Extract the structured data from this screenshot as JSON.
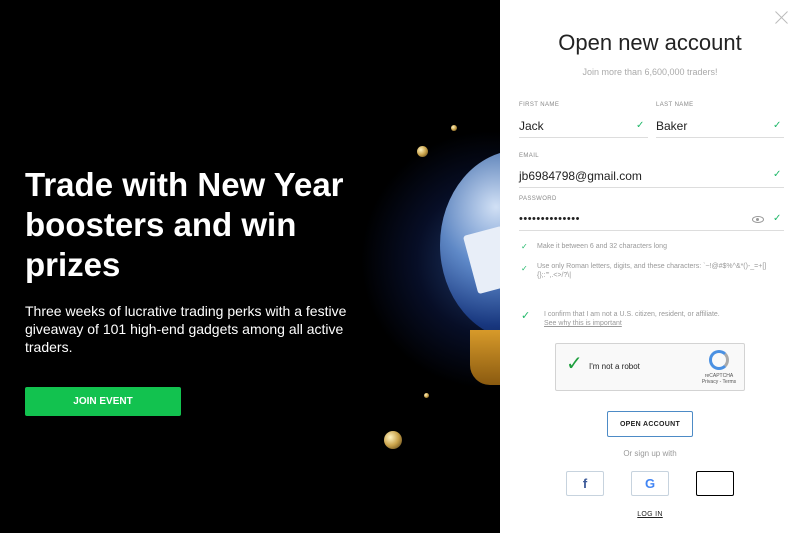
{
  "promo": {
    "headline": "Trade with New Year boosters and win prizes",
    "subtext": "Three weeks of lucrative trading perks with a festive giveaway of 101 high-end gadgets among all active traders.",
    "join_label": "JOIN EVENT"
  },
  "form": {
    "title": "Open new account",
    "subtitle": "Join more than 6,600,000 traders!",
    "first_name": {
      "label": "FIRST NAME",
      "value": "Jack"
    },
    "last_name": {
      "label": "LAST NAME",
      "value": "Baker"
    },
    "email": {
      "label": "EMAIL",
      "value": "jb6984798@gmail.com"
    },
    "password": {
      "label": "PASSWORD",
      "value": "••••••••••••••"
    },
    "rules": [
      "Make it between 6 and 32 characters long",
      "Use only Roman letters, digits, and these characters: `~!@#$%^&*()-_=+[]{};:'\",.<>/?\\|"
    ],
    "confirm_text": "I confirm that I am not a U.S. citizen, resident, or affiliate.",
    "confirm_link": "See why this is important",
    "captcha": {
      "text": "I'm not a robot",
      "brand": "reCAPTCHA",
      "links": "Privacy - Terms"
    },
    "open_label": "OPEN ACCOUNT",
    "or_text": "Or sign up with",
    "social": {
      "facebook": "f",
      "google": "G",
      "apple": ""
    },
    "login_label": "LOG IN"
  },
  "colors": {
    "accent_green": "#12c24f",
    "check_green": "#21b86a",
    "button_border": "#4d8bc6"
  }
}
